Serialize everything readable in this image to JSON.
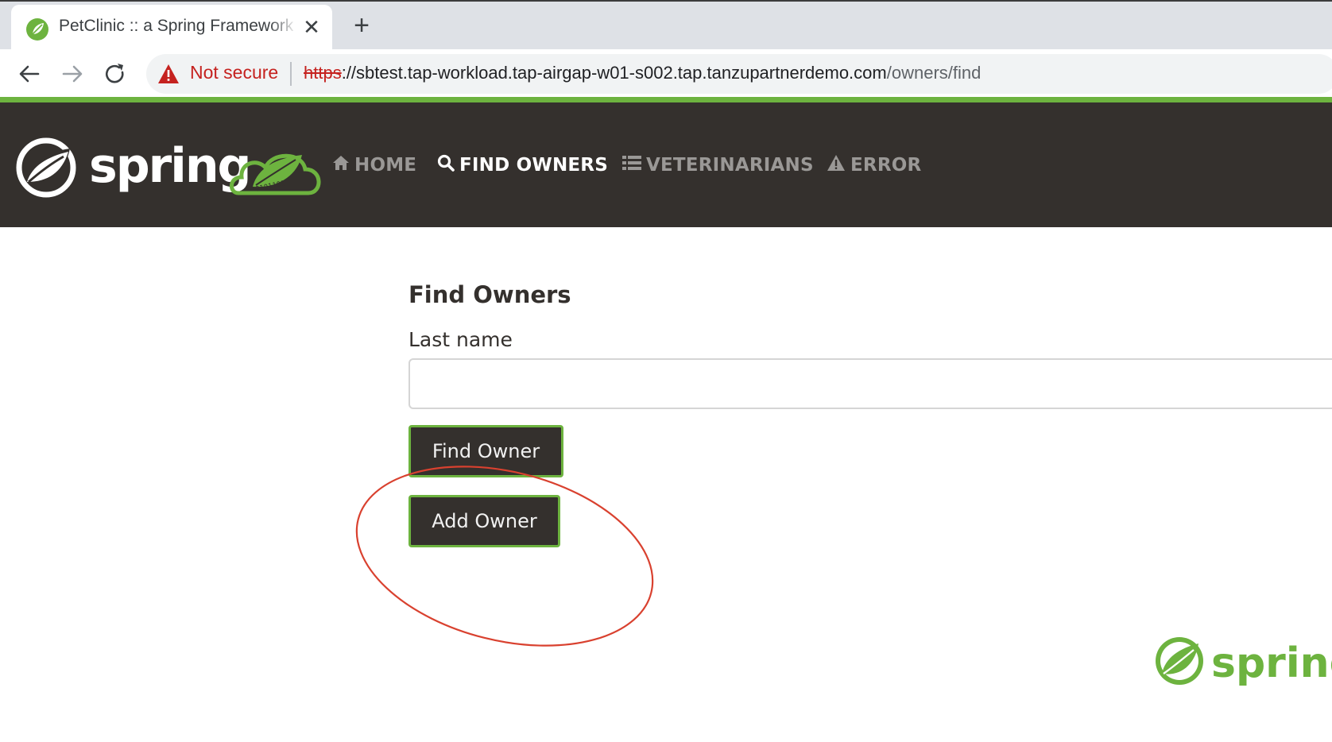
{
  "browser": {
    "tab_title": "PetClinic :: a Spring Framework demonstration",
    "security_label": "Not secure",
    "url_scheme": "https",
    "url_host": "://sbtest.tap-workload.tap-airgap-w01-s002.tap.tanzupartnerdemo.com",
    "url_path": "/owners/find"
  },
  "navbar": {
    "brand": "spring",
    "badge_digits": "0101101",
    "items": [
      {
        "label": "HOME",
        "icon": "home-icon"
      },
      {
        "label": "FIND OWNERS",
        "icon": "search-icon"
      },
      {
        "label": "VETERINARIANS",
        "icon": "list-icon"
      },
      {
        "label": "ERROR",
        "icon": "warning-icon"
      }
    ]
  },
  "main": {
    "title": "Find Owners",
    "last_name_label": "Last name",
    "last_name_value": "",
    "find_button": "Find Owner",
    "add_button": "Add Owner"
  },
  "footer": {
    "logo_text": "spring"
  },
  "colors": {
    "spring_green": "#6db33f",
    "navbar_bg": "#34302d",
    "annotation_red": "#d9412f"
  }
}
